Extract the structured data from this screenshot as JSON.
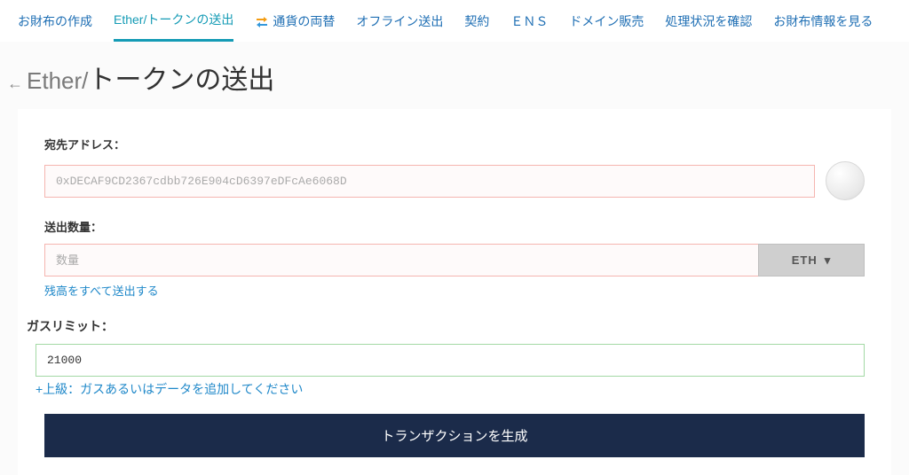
{
  "nav": {
    "items": [
      {
        "label": "お財布の作成"
      },
      {
        "label": "Ether/トークンの送出",
        "active": true
      },
      {
        "label": "通貨の両替",
        "icon": true
      },
      {
        "label": "オフライン送出"
      },
      {
        "label": "契約"
      },
      {
        "label": "ＥＮＳ"
      },
      {
        "label": "ドメイン販売"
      },
      {
        "label": "処理状況を確認"
      },
      {
        "label": "お財布情報を見る"
      }
    ]
  },
  "page": {
    "title_prefix": "Ether/",
    "title_main": "トークンの送出"
  },
  "form": {
    "address_label": "宛先アドレス：",
    "address_placeholder": "0xDECAF9CD2367cdbb726E904cD6397eDFcAe6068D",
    "address_value": "",
    "amount_label": "送出数量：",
    "amount_placeholder": "数量",
    "amount_value": "",
    "currency_label": "ETH",
    "send_all_link": "残高をすべて送出する",
    "gas_label": "ガスリミット：",
    "gas_value": "21000",
    "advanced_link": "+上級：ガスあるいはデータを追加してください",
    "generate_button": "トランザクションを生成"
  }
}
